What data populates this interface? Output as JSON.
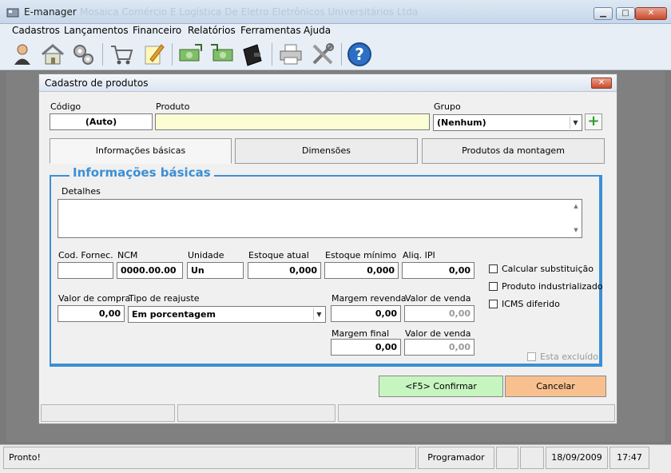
{
  "window": {
    "title": "E-manager",
    "subtitle": "Mosaica Comércio E Logística De Eletro Eletrônicos Universitários Ltda"
  },
  "menu": {
    "items": [
      {
        "label": "Cadastros"
      },
      {
        "label": "Lançamentos"
      },
      {
        "label": "Financeiro"
      },
      {
        "label": "Relatórios"
      },
      {
        "label": "Ferramentas"
      },
      {
        "label": "Ajuda"
      }
    ]
  },
  "toolbar": {
    "icons": [
      "user-icon",
      "house-icon",
      "gears-icon",
      "cart-icon",
      "edit-note-icon",
      "money-out-icon",
      "money-in-icon",
      "wallet-icon",
      "printer-icon",
      "tools-icon",
      "help-icon"
    ]
  },
  "dialog": {
    "title": "Cadastro de produtos",
    "codigo_label": "Código",
    "codigo_value": "(Auto)",
    "produto_label": "Produto",
    "produto_value": "",
    "grupo_label": "Grupo",
    "grupo_value": "(Nenhum)",
    "tabs": [
      {
        "label": "Informações básicas"
      },
      {
        "label": "Dimensões"
      },
      {
        "label": "Produtos da montagem"
      }
    ],
    "group_title": "Informações básicas",
    "detalhes_label": "Detalhes",
    "fields": {
      "cod_fornec_label": "Cod. Fornec.",
      "cod_fornec_value": "",
      "ncm_label": "NCM",
      "ncm_value": "0000.00.00",
      "unidade_label": "Unidade",
      "unidade_value": "Un",
      "estoque_atual_label": "Estoque atual",
      "estoque_atual_value": "0,000",
      "estoque_minimo_label": "Estoque mínimo",
      "estoque_minimo_value": "0,000",
      "aliq_ipi_label": "Aliq. IPI",
      "aliq_ipi_value": "0,00",
      "valor_compra_label": "Valor de compra",
      "valor_compra_value": "0,00",
      "tipo_reajuste_label": "Tipo de reajuste",
      "tipo_reajuste_value": "Em porcentagem",
      "margem_revenda_label": "Margem revenda",
      "margem_revenda_value": "0,00",
      "valor_venda_label": "Valor de venda",
      "valor_venda_value": "0,00",
      "margem_final_label": "Margem final",
      "margem_final_value": "0,00",
      "valor_venda2_label": "Valor de venda",
      "valor_venda2_value": "0,00"
    },
    "checkboxes": {
      "calc_subst": "Calcular substituição",
      "prod_indust": "Produto industrializado",
      "icms_diferido": "ICMS diferido",
      "esta_excluido": "Esta excluído"
    },
    "buttons": {
      "confirmar": "<F5> Confirmar",
      "cancelar": "Cancelar"
    }
  },
  "statusbar": {
    "status": "Pronto!",
    "user": "Programador",
    "date": "18/09/2009",
    "time": "17:47"
  },
  "colors": {
    "accent": "#3c8fd4",
    "confirm_bg": "#c6f5c0",
    "cancel_bg": "#f8c08f",
    "produto_bg": "#fdfdd5"
  }
}
